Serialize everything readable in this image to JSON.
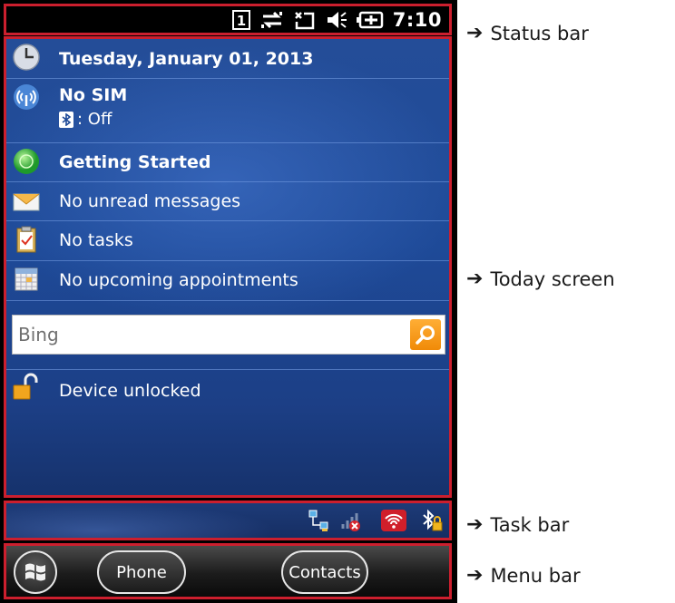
{
  "status_bar": {
    "time": "7:10",
    "icons": [
      "sim-slot-1-icon",
      "data-connection-icon",
      "no-signal-icon",
      "speaker-muted-icon",
      "battery-charging-icon"
    ]
  },
  "today": {
    "date": "Tuesday, January 01, 2013",
    "sim_status": "No SIM",
    "bluetooth_status": ": Off",
    "getting_started": "Getting Started",
    "messages": "No unread messages",
    "tasks": "No tasks",
    "appointments": "No upcoming appointments",
    "search": {
      "placeholder": "Bing"
    },
    "lock_status": "Device unlocked"
  },
  "task_bar": {
    "icons": [
      "network-icon",
      "no-signal-tray-icon",
      "wifi-icon",
      "bluetooth-locked-icon"
    ]
  },
  "menu_bar": {
    "left_soft_key": "Phone",
    "right_soft_key": "Contacts"
  },
  "annotations": {
    "status_bar": "Status bar",
    "today_screen": "Today screen",
    "task_bar": "Task bar",
    "menu_bar": "Menu bar"
  },
  "colors": {
    "highlight_border": "#cc1f2e",
    "today_background": "#1e4a98",
    "search_button": "#f5960f"
  }
}
